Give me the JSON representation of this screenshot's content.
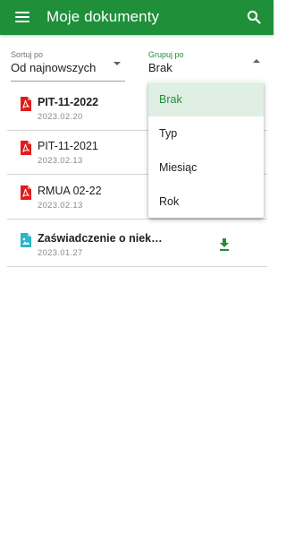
{
  "appbar": {
    "title": "Moje dokumenty",
    "menu_icon": "hamburger-menu-icon",
    "search_icon": "search-icon",
    "color": "#1f8f3a"
  },
  "sort": {
    "label": "Sortuj po",
    "value": "Od najnowszych"
  },
  "group": {
    "label": "Grupuj po",
    "value": "Brak"
  },
  "dropdown": {
    "options": [
      "Brak",
      "Typ",
      "Miesiąc",
      "Rok"
    ],
    "selected": "Brak"
  },
  "documents": [
    {
      "name": "PIT-11-2022",
      "date": "2023.02.20",
      "type_icon": "pdf-icon",
      "bold": true
    },
    {
      "name": "PIT-11-2021",
      "date": "2023.02.13",
      "type_icon": "pdf-icon",
      "bold": false
    },
    {
      "name": "RMUA 02-22",
      "date": "2023.02.13",
      "type_icon": "pdf-icon",
      "bold": false
    },
    {
      "name": "Zaświadczenie o niek…",
      "date": "2023.01.27",
      "type_icon": "image-file-icon",
      "bold": true,
      "download_icon": "download-icon"
    }
  ]
}
